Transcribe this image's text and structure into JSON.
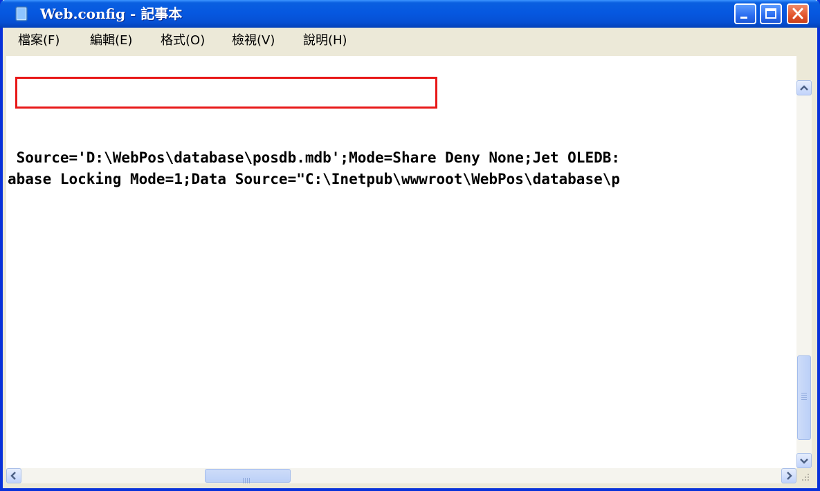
{
  "window": {
    "title": "Web.config - 記事本"
  },
  "menu": {
    "items": [
      {
        "label": "檔案(F)"
      },
      {
        "label": "編輯(E)"
      },
      {
        "label": "格式(O)"
      },
      {
        "label": "檢視(V)"
      },
      {
        "label": "說明(H)"
      }
    ]
  },
  "editor": {
    "lines": [
      " Source='D:\\WebPos\\database\\posdb.mdb';Mode=Share Deny None;Jet OLEDB:",
      "abase Locking Mode=1;Data Source=\"C:\\Inetpub\\wwwroot\\WebPos\\database\\p"
    ]
  },
  "colors": {
    "titlebar": "#0658e0",
    "highlight": "#e81818",
    "chrome": "#ece9d8"
  },
  "scrollbars": {
    "vertical_position": 0.8,
    "horizontal_position": 0.25
  }
}
